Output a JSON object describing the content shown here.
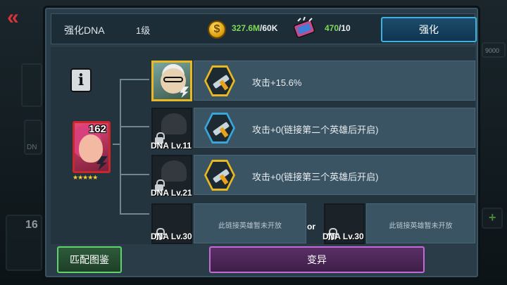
{
  "header": {
    "title": "强化DNA",
    "level": "1级",
    "coin_symbol": "$",
    "coin_current": "327.6M",
    "coin_required": "/60K",
    "dna_current": "470",
    "dna_required": "/10",
    "upgrade_label": "强化"
  },
  "hero": {
    "number": "162",
    "stars": "★★★★★"
  },
  "info_symbol": "i",
  "links": [
    {
      "text": "攻击+15.6%",
      "slot_label": "",
      "state": "active"
    },
    {
      "text": "攻击+0(链接第二个英雄后开启)",
      "slot_label": "DNA Lv.11",
      "state": "locked"
    },
    {
      "text": "攻击+0(链接第三个英雄后开启)",
      "slot_label": "DNA Lv.21",
      "state": "locked"
    }
  ],
  "final_slots": [
    {
      "slot_label": "DNA Lv.30",
      "text": "此链接英雄暂未开放"
    },
    {
      "slot_label": "DNA Lv.30",
      "text": "此链接英雄暂未开放"
    }
  ],
  "or_label": "or",
  "buttons": {
    "atlas_label": "匹配图鉴",
    "mutate_label": "变异"
  },
  "background": {
    "back_symbol": "«",
    "side_value": "9000",
    "side_number": "16",
    "side_letters": "DN"
  },
  "colors": {
    "resource_green": "#7ed957",
    "upgrade_border": "#3fb0e0",
    "atlas_border": "#5fd36d",
    "mutate_border": "#c46ad8",
    "active_slot_border": "#e8b923",
    "badge_gold": "#e8b923",
    "badge_blue": "#39a5d8"
  },
  "icons": [
    "back-arrows-icon",
    "coin-icon",
    "dna-icon",
    "info-icon",
    "sword-icon",
    "lock-icon",
    "lightning-icon",
    "star-icon"
  ]
}
